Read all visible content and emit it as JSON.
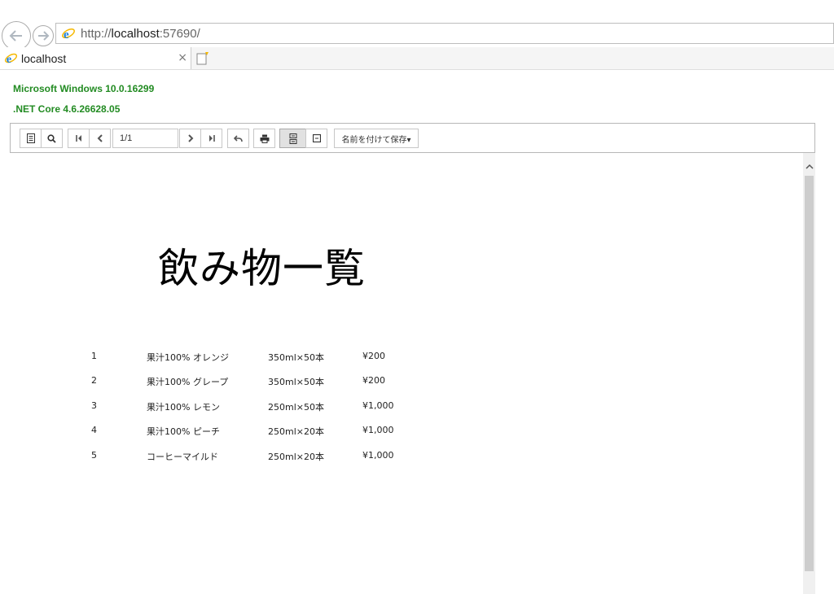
{
  "browser": {
    "url_prefix": "http://",
    "url_host": "localhost",
    "url_suffix": ":57690/",
    "tab_title": "localhost",
    "tab_close": "×"
  },
  "system": {
    "os": "Microsoft Windows 10.0.16299",
    "runtime": ".NET Core 4.6.26628.05"
  },
  "toolbar": {
    "page_value": "1/1",
    "save_label": "名前を付けて保存▾",
    "active_button": "single-page"
  },
  "report": {
    "title": "飲み物一覧",
    "rows": [
      {
        "no": "1",
        "name": "果汁100% オレンジ",
        "volume": "350ml×50本",
        "price": "¥200"
      },
      {
        "no": "2",
        "name": "果汁100% グレープ",
        "volume": "350ml×50本",
        "price": "¥200"
      },
      {
        "no": "3",
        "name": "果汁100% レモン",
        "volume": "250ml×50本",
        "price": "¥1,000"
      },
      {
        "no": "4",
        "name": "果汁100% ピーチ",
        "volume": "250ml×20本",
        "price": "¥1,000"
      },
      {
        "no": "5",
        "name": "コーヒーマイルド",
        "volume": "250ml×20本",
        "price": "¥1,000"
      }
    ]
  },
  "colors": {
    "sysinfo_text": "#228b22",
    "ie_blue": "#1e7fd6",
    "ie_ring": "#f5b800"
  },
  "icons": [
    "back-arrow-icon",
    "forward-arrow-icon",
    "ie-logo-icon",
    "new-tab-icon",
    "document-map-icon",
    "search-icon",
    "first-page-icon",
    "previous-page-icon",
    "next-page-icon",
    "last-page-icon",
    "back-to-parent-icon",
    "print-icon",
    "continuous-pages-icon",
    "single-page-icon",
    "scroll-up-icon"
  ]
}
